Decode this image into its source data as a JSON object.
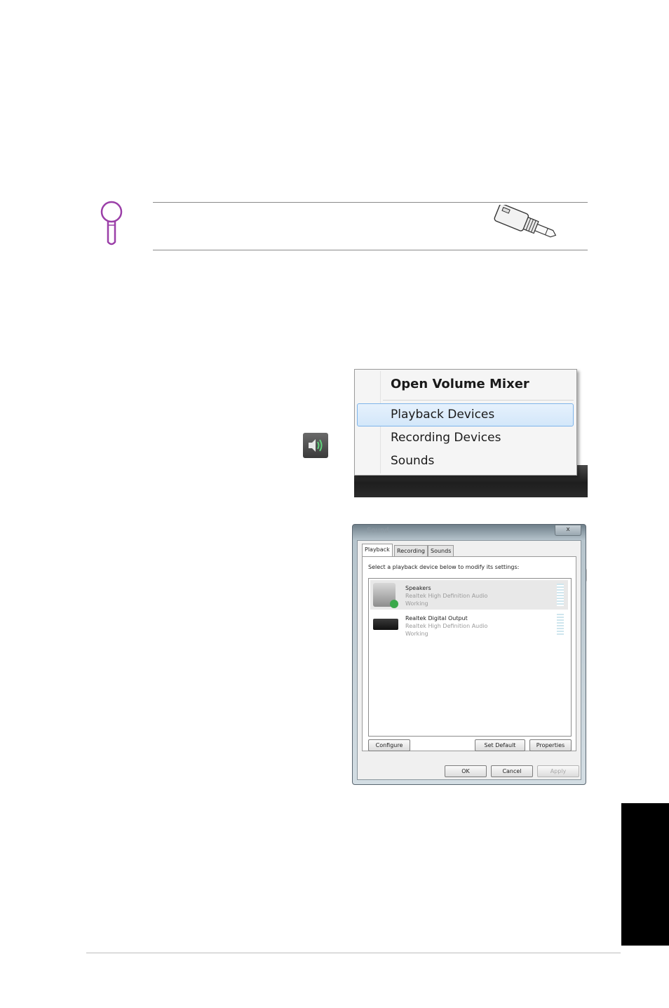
{
  "context_menu": {
    "items": [
      {
        "label": "Open Volume Mixer"
      },
      {
        "label": "Playback Devices"
      },
      {
        "label": "Recording Devices"
      },
      {
        "label": "Sounds"
      }
    ]
  },
  "sound_dialog": {
    "title": "Sound",
    "close_label": "x",
    "tabs": [
      "Playback",
      "Recording",
      "Sounds"
    ],
    "instruction": "Select a playback device below to modify its settings:",
    "devices": [
      {
        "name": "Speakers",
        "driver": "Realtek High Definition Audio",
        "status": "Working"
      },
      {
        "name": "Realtek Digital Output",
        "driver": "Realtek High Definition Audio",
        "status": "Working"
      }
    ],
    "buttons": {
      "configure": "Configure",
      "set_default": "Set Default",
      "properties": "Properties",
      "ok": "OK",
      "cancel": "Cancel",
      "apply": "Apply"
    }
  },
  "colors": {
    "note_icon": "#9b3fa8",
    "menu_highlight": "#d3e7fa",
    "side_tab": "#000000"
  },
  "icons": [
    "magnifier-note-icon",
    "audio-jack-icon",
    "speaker-volume-icon"
  ]
}
